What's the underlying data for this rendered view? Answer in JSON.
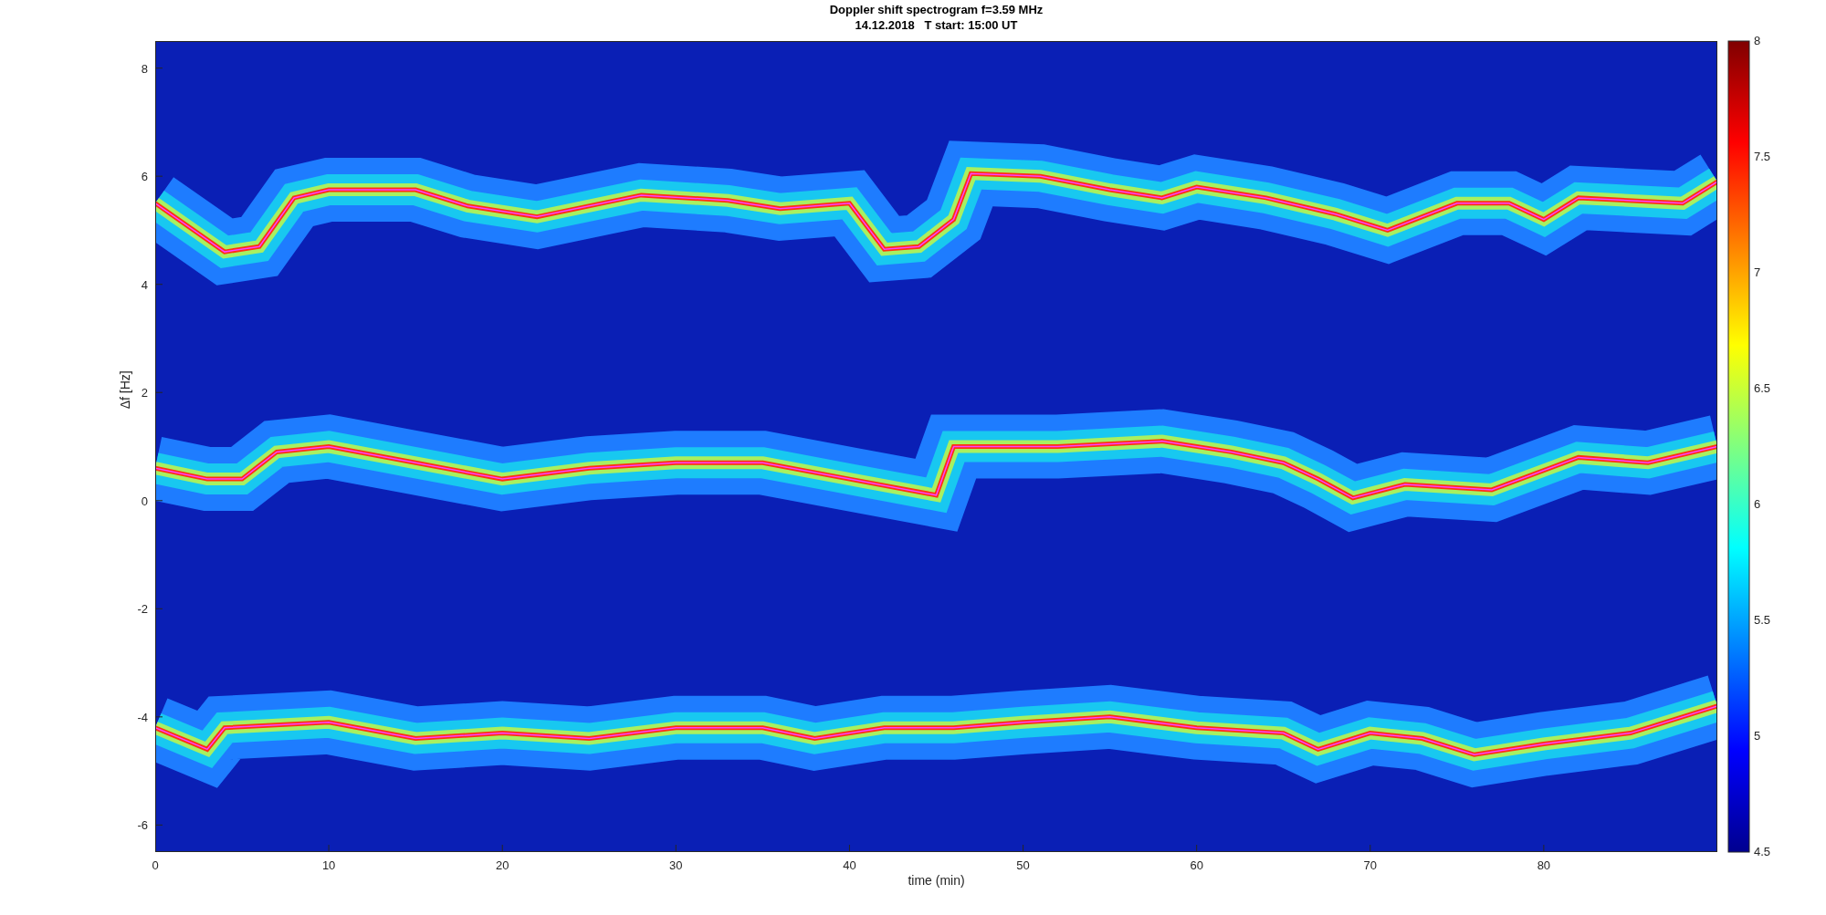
{
  "title": {
    "line_1": "Doppler shift spectrogram f=3.59 MHz",
    "line_2": "14.12.2018   T start: 15:00 UT"
  },
  "x_axis": {
    "label": "time (min)",
    "ticks": [
      "0",
      "10",
      "20",
      "30",
      "40",
      "50",
      "60",
      "70",
      "80"
    ]
  },
  "y_axis": {
    "label": "Δf [Hz]",
    "ticks": [
      "8",
      "6",
      "4",
      "2",
      "0",
      "-2",
      "-4",
      "-6"
    ]
  },
  "colorbar": {
    "ticks": [
      "8",
      "7.5",
      "7",
      "6.5",
      "6",
      "5.5",
      "5",
      "4.5"
    ]
  }
}
